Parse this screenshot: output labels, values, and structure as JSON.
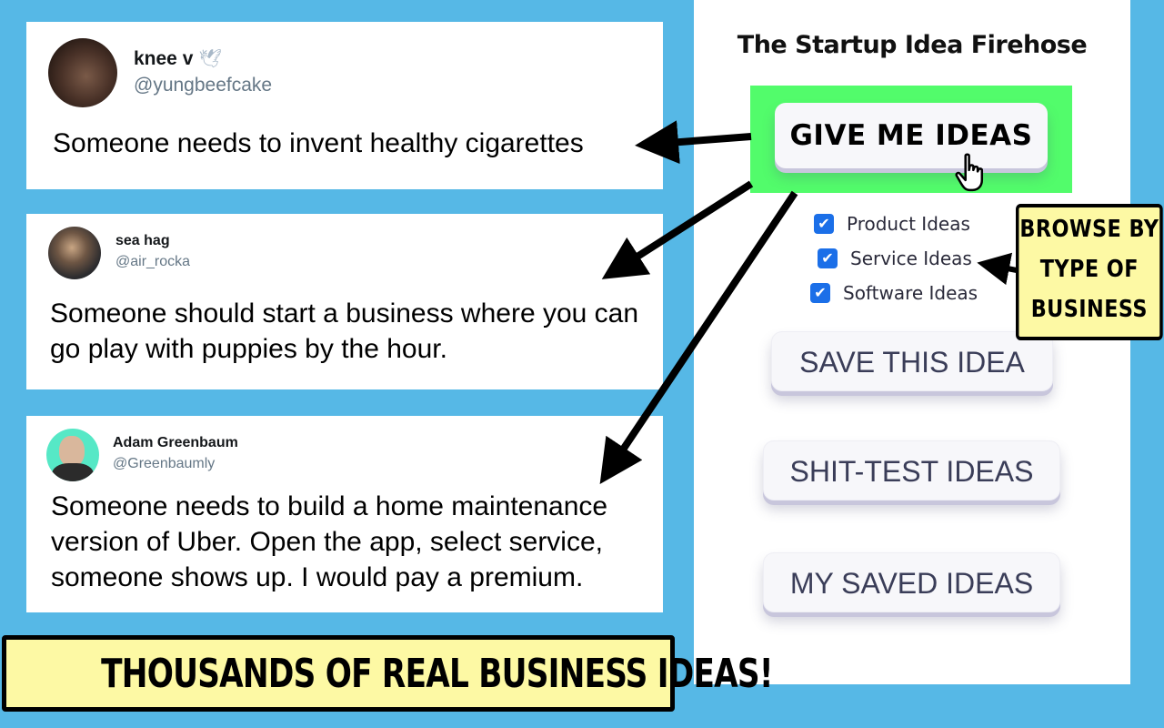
{
  "tweets": [
    {
      "name": "knee v",
      "name_icon": "dove-icon",
      "handle": "@yungbeefcake",
      "text": "Someone needs to invent healthy cigarettes"
    },
    {
      "name": "sea hag",
      "handle": "@air_rocka",
      "text": "Someone should start a business where you can go play with puppies by the hour."
    },
    {
      "name": "Adam Greenbaum",
      "handle": "@Greenbaumly",
      "text": "Someone needs to build a home maintenance version of Uber. Open the app, select service, someone shows up. I would pay a premium."
    }
  ],
  "panel": {
    "title": "The Startup Idea Firehose",
    "give_button": "GIVE ME IDEAS",
    "options": [
      {
        "label": "Product Ideas",
        "checked": true
      },
      {
        "label": "Service Ideas",
        "checked": true
      },
      {
        "label": "Software Ideas",
        "checked": true
      }
    ],
    "checkmark": "✔",
    "save_button": "SAVE THIS IDEA",
    "test_button": "SHIT-TEST IDEAS",
    "saved_button": "MY SAVED IDEAS"
  },
  "callouts": {
    "browse_line1": "BROWSE BY",
    "browse_line2": "TYPE OF",
    "browse_line3": "BUSINESS",
    "banner": "THOUSANDS OF REAL BUSINESS IDEAS!"
  },
  "colors": {
    "background": "#56b8e6",
    "highlight": "#52fc6b",
    "callout": "#fdf9a4",
    "checkbox": "#1b6fe8"
  }
}
